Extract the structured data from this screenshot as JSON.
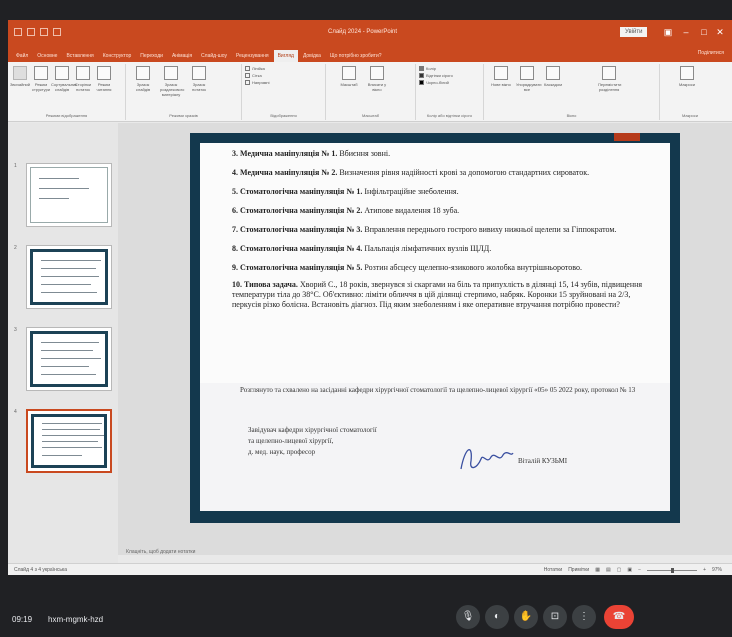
{
  "window": {
    "title": "Слайд 2024 - PowerPoint",
    "signin": "Увійти",
    "share": "Поділитися"
  },
  "tabs": [
    "Файл",
    "Основне",
    "Вставлення",
    "Конструктор",
    "Переходи",
    "Анімація",
    "Слайд-шоу",
    "Рецензування",
    "Вигляд",
    "Довідка",
    "Що потрібно зробити?"
  ],
  "active_tab_index": 8,
  "ribbon": {
    "groups": [
      {
        "label": "Режими відображення",
        "buttons": [
          "Звичайний",
          "Режим структури",
          "Сортувальник слайдів",
          "Сторінки нотаток",
          "Режим читання"
        ]
      },
      {
        "label": "Режими зразків",
        "buttons": [
          "Зразок слайдів",
          "Зразок роздаткового матеріалу",
          "Зразок нотаток"
        ]
      },
      {
        "label": "Відображення",
        "checks": [
          "Лінійка",
          "Сітка",
          "Напрямні"
        ]
      },
      {
        "label": "Масштаб",
        "buttons": [
          "Масштаб",
          "Вписати у вікно"
        ]
      },
      {
        "label": "Колір або відтінки сірого",
        "checks": [
          "Колір",
          "Відтінки сірого",
          "Чорно-білий"
        ]
      },
      {
        "label": "Вікно",
        "buttons": [
          "Нове вікно",
          "Упорядкувати все",
          "Каскадом",
          "Перемістити розділення"
        ]
      },
      {
        "label": "Макроси",
        "buttons": [
          "Макроси"
        ]
      }
    ]
  },
  "thumbnails": [
    {
      "num": "1",
      "selected": false
    },
    {
      "num": "2",
      "selected": false
    },
    {
      "num": "3",
      "selected": false
    },
    {
      "num": "4",
      "selected": true
    }
  ],
  "slide": {
    "items": [
      {
        "head": "3. Медична маніпуляція № 1.",
        "body": "Вбиєння зовні."
      },
      {
        "head": "4. Медична маніпуляція № 2.",
        "body": "Визначення рівня надійності крові за допомогою стандартних сироваток."
      },
      {
        "head": "5. Стоматологічна маніпуляція № 1.",
        "body": "Інфільтраційне знеболення."
      },
      {
        "head": "6. Стоматологічна маніпуляція № 2.",
        "body": "Атипове видалення 18 зуба."
      },
      {
        "head": "7. Стоматологічна маніпуляція № 3.",
        "body": "Вправлення переднього гострого вивиху нижньої щелепи за Гіппократом."
      },
      {
        "head": "8. Стоматологічна маніпуляція № 4.",
        "body": "Пальпація лімфатичних вузлів ЩЛД."
      },
      {
        "head": "9. Стоматологічна маніпуляція № 5.",
        "body": "Розтин абсцесу щелепно-язикового жолобка внутрішньоротово."
      }
    ],
    "task_head": "10. Типова задача.",
    "task_body": "Хворий С., 18 років, звернувся зі скаргами на біль та припухлість в ділянці 15, 14 зубів, підвищення температури тіла до 38°С. Об'єктивно: ліміти обличчя в цій ділянці стерпимо, набряк. Коронки 15 зруйновані на 2/3, перкусія різко болісна. Встановіть діагноз. Під яким знеболенням і яке оперативне втручання потрібно провести?",
    "footer": "Розглянуто та схвалено на засіданні кафедри хірургічної стоматології та щелепно-лицевої хірургії «05» 05 2022 року, протокол № 13",
    "signature_block": [
      "Завідувач кафедри хірургічної стоматології",
      "та щелепно-лицевої хірургії,",
      "д. мед. наук, професор"
    ],
    "signature_name": "Віталій КУЗЬМІ"
  },
  "notes_placeholder": "Клацніть, щоб додати нотатки",
  "status": {
    "left": "Слайд 4 з 4   українська",
    "notes": "Нотатки",
    "comments": "Примітки",
    "zoom": "97%"
  },
  "meet": {
    "clock": "09:19",
    "code": "hxm-mgmk-hzd",
    "controls": [
      "mic",
      "camera",
      "hand",
      "present",
      "more",
      "end"
    ]
  }
}
